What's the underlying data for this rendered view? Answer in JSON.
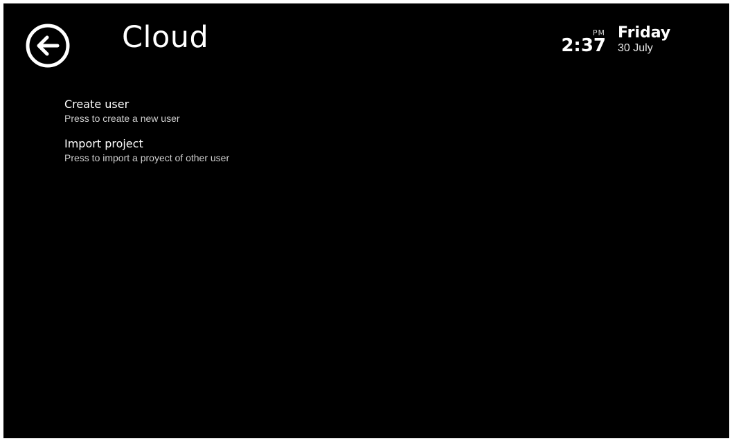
{
  "header": {
    "title": "Cloud",
    "back_icon": "arrow-left-circle-icon"
  },
  "clock": {
    "ampm": "PM",
    "time": "2:37"
  },
  "date": {
    "day": "Friday",
    "date": "30 July"
  },
  "menu": {
    "items": [
      {
        "title": "Create user",
        "subtitle": "Press to create a new user"
      },
      {
        "title": "Import project",
        "subtitle": "Press to import a proyect of other user"
      }
    ]
  },
  "colors": {
    "background": "#000000",
    "text": "#ffffff",
    "subtext": "#cfcfcf"
  }
}
